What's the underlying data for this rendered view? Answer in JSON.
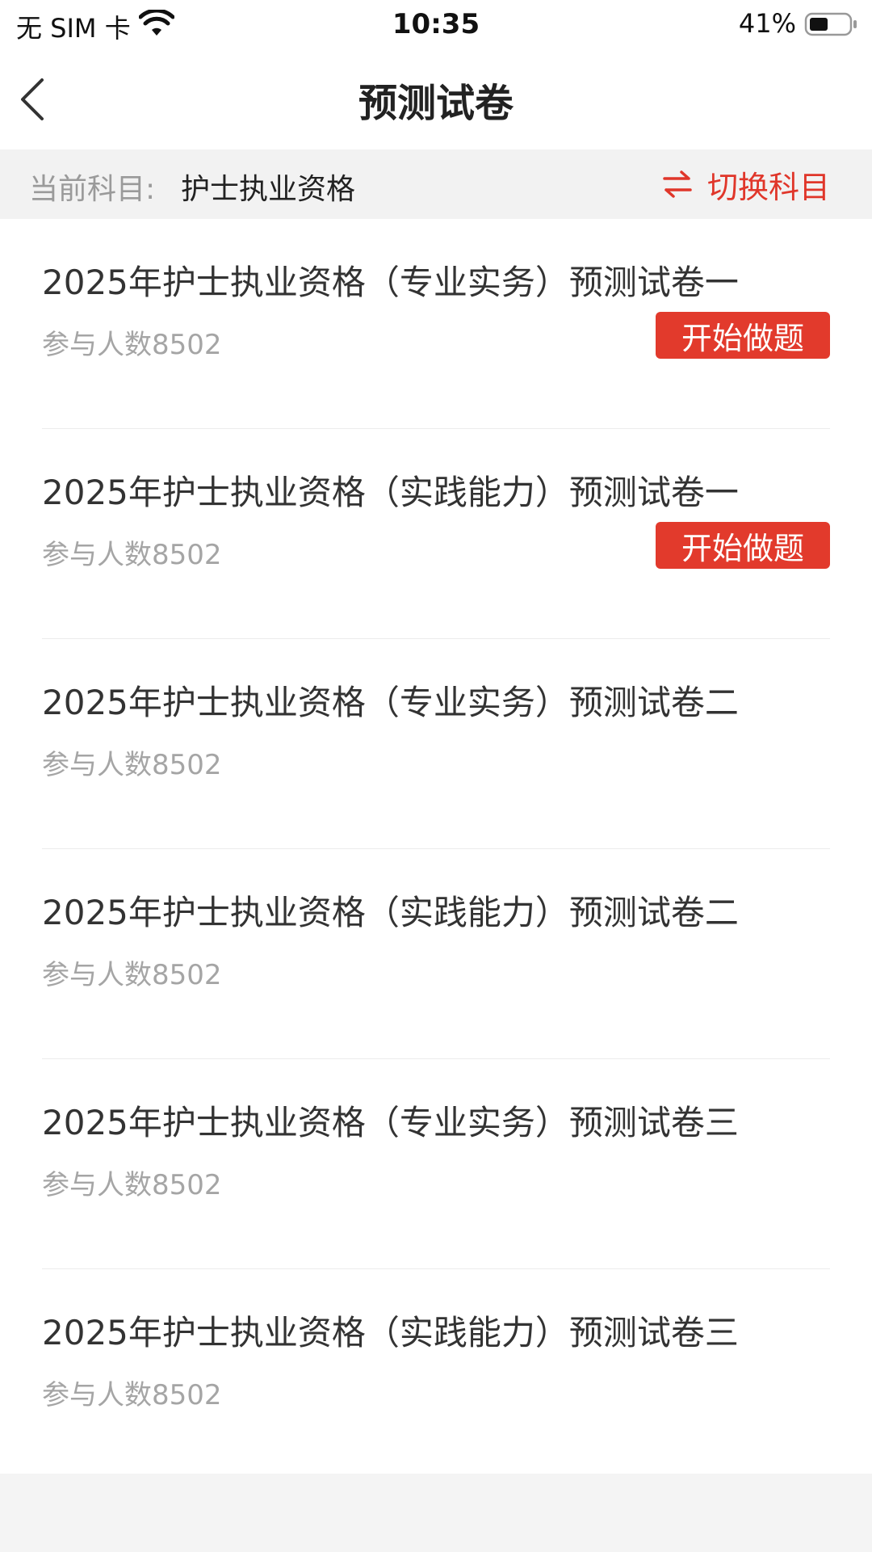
{
  "status_bar": {
    "carrier": "无 SIM 卡",
    "time": "10:35",
    "battery": "41%"
  },
  "nav": {
    "title": "预测试卷"
  },
  "subject": {
    "label": "当前科目:",
    "value": "护士执业资格",
    "switch_label": "切换科目",
    "accent_color": "#e0362a"
  },
  "papers": [
    {
      "title": "2025年护士执业资格（专业实务）预测试卷一",
      "count": "参与人数8502",
      "button": "开始做题"
    },
    {
      "title": "2025年护士执业资格（实践能力）预测试卷一",
      "count": "参与人数8502",
      "button": "开始做题"
    },
    {
      "title": "2025年护士执业资格（专业实务）预测试卷二",
      "count": "参与人数8502"
    },
    {
      "title": "2025年护士执业资格（实践能力）预测试卷二",
      "count": "参与人数8502"
    },
    {
      "title": "2025年护士执业资格（专业实务）预测试卷三",
      "count": "参与人数8502"
    },
    {
      "title": "2025年护士执业资格（实践能力）预测试卷三",
      "count": "参与人数8502"
    }
  ]
}
